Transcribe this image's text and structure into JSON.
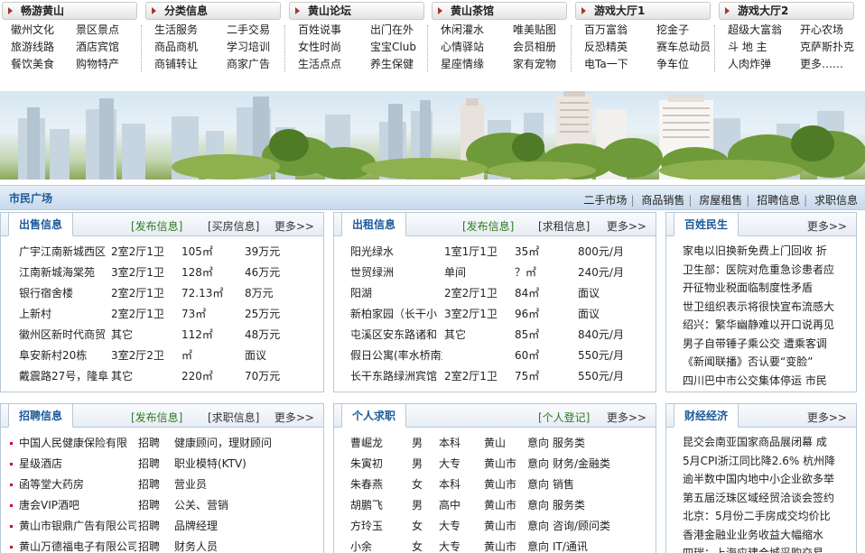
{
  "topnav": {
    "columns": [
      {
        "title": "畅游黄山",
        "links": [
          "徽州文化",
          "景区景点",
          "旅游线路",
          "酒店宾馆",
          "餐饮美食",
          "购物特产"
        ]
      },
      {
        "title": "分类信息",
        "links": [
          "生活服务",
          "二手交易",
          "商品商机",
          "学习培训",
          "商铺转让",
          "商家广告"
        ]
      },
      {
        "title": "黄山论坛",
        "links": [
          "百姓说事",
          "出门在外",
          "女性时尚",
          "宝宝Club",
          "生活点点",
          "养生保健"
        ]
      },
      {
        "title": "黄山茶馆",
        "links": [
          "休闲灌水",
          "唯美贴图",
          "心情驿站",
          "会员相册",
          "星座情缘",
          "家有宠物"
        ]
      },
      {
        "title": "游戏大厅1",
        "links": [
          "百万富翁",
          "挖金子",
          "反恐精英",
          "赛车总动员",
          "电Ta一下",
          "争车位"
        ]
      },
      {
        "title": "游戏大厅2",
        "links": [
          "超级大富翁",
          "开心农场",
          "斗 地 主",
          "克萨斯扑克",
          "人肉炸弹",
          "更多……"
        ]
      }
    ]
  },
  "plaza": {
    "title": "市民广场",
    "links": [
      "二手市场",
      "商品销售",
      "房屋租售",
      "招聘信息",
      "求职信息"
    ]
  },
  "panels": {
    "sale": {
      "tab": "出售信息",
      "link1": "[发布信息]",
      "link2": "[买房信息]",
      "more": "更多>>",
      "rows": [
        [
          "广宇江南新城西区",
          "2室2厅1卫",
          "105㎡",
          "39万元"
        ],
        [
          "江南新城海棠苑",
          "3室2厅1卫",
          "128㎡",
          "46万元"
        ],
        [
          "银行宿舍楼",
          "2室2厅1卫",
          "72.13㎡",
          "8万元"
        ],
        [
          "上新村",
          "2室2厅1卫",
          "73㎡",
          "25万元"
        ],
        [
          "徽州区新时代商贸",
          "其它",
          "112㎡",
          "48万元"
        ],
        [
          "阜安新村20栋",
          "3室2厅2卫",
          "㎡",
          "面议"
        ],
        [
          "戴震路27号，隆阜",
          "其它",
          "220㎡",
          "70万元"
        ]
      ]
    },
    "rent": {
      "tab": "出租信息",
      "link1": "[发布信息]",
      "link2": "[求租信息]",
      "more": "更多>>",
      "rows": [
        [
          "阳光绿水",
          "1室1厅1卫",
          "35㎡",
          "800元/月"
        ],
        [
          "世贸绿洲",
          "单间",
          "？㎡",
          "240元/月"
        ],
        [
          "阳湖",
          "2室2厅1卫",
          "84㎡",
          "面议"
        ],
        [
          "新柏家园（长干小",
          "3室2厅1卫",
          "96㎡",
          "面议"
        ],
        [
          "屯溪区安东路诸和",
          "其它",
          "85㎡",
          "840元/月"
        ],
        [
          "假日公寓(率水桥南复式",
          "",
          "60㎡",
          "550元/月"
        ],
        [
          "长干东路绿洲宾馆",
          "2室2厅1卫",
          "75㎡",
          "550元/月"
        ]
      ]
    },
    "people": {
      "tab": "百姓民生",
      "more": "更多>>",
      "rows": [
        "家电以旧换新免费上门回收 折",
        "卫生部：医院对危重急诊患者应",
        "开征物业税面临制度性矛盾",
        "世卫组织表示将很快宣布流感大",
        "绍兴：繁华幽静难以开口说再见",
        "男子自带锤子乘公交 遭乘客调",
        "《新闻联播》否认要“变脸”",
        "四川巴中市公交集体停运 市民"
      ]
    },
    "jobs": {
      "tab": "招聘信息",
      "link1": "[发布信息]",
      "link2": "[求职信息]",
      "more": "更多>>",
      "rows": [
        [
          "中国人民健康保险有限",
          "招聘",
          "健康顾问，理财顾问"
        ],
        [
          "星级酒店",
          "招聘",
          "职业模特(KTV)"
        ],
        [
          "函等堂大药房",
          "招聘",
          "营业员"
        ],
        [
          "唐会VIP酒吧",
          "招聘",
          "公关、营销"
        ],
        [
          "黄山市银鼎广告有限公司",
          "招聘",
          "品牌经理"
        ],
        [
          "黄山万德福电子有限公司",
          "招聘",
          "财务人员"
        ]
      ]
    },
    "seek": {
      "tab": "个人求职",
      "link1": "[个人登记]",
      "more": "更多>>",
      "rows": [
        [
          "曹崛龙",
          "男",
          "本科",
          "黄山",
          "意向",
          "服务类"
        ],
        [
          "朱寅初",
          "男",
          "大专",
          "黄山市",
          "意向",
          "财务/金融类"
        ],
        [
          "朱春燕",
          "女",
          "本科",
          "黄山市",
          "意向",
          "销售"
        ],
        [
          "胡鹏飞",
          "男",
          "高中",
          "黄山市",
          "意向",
          "服务类"
        ],
        [
          "方玲玉",
          "女",
          "大专",
          "黄山市",
          "意向",
          "咨询/顾问类"
        ],
        [
          "小余",
          "女",
          "大专",
          "黄山市",
          "意向",
          "IT/通讯"
        ]
      ]
    },
    "finance": {
      "tab": "财经经济",
      "more": "更多>>",
      "rows": [
        "昆交会南亚国家商品展闭幕 成",
        "5月CPI浙江同比降2.6% 杭州降",
        "逾半数中国内地中小企业欲多举",
        "第五届泛珠区域经贸洽谈会签约",
        "北京：5月份二手房成交均价比",
        "香港金融业业务收益大幅缩水",
        "四瑞：上海应建合城采购交易"
      ]
    }
  }
}
